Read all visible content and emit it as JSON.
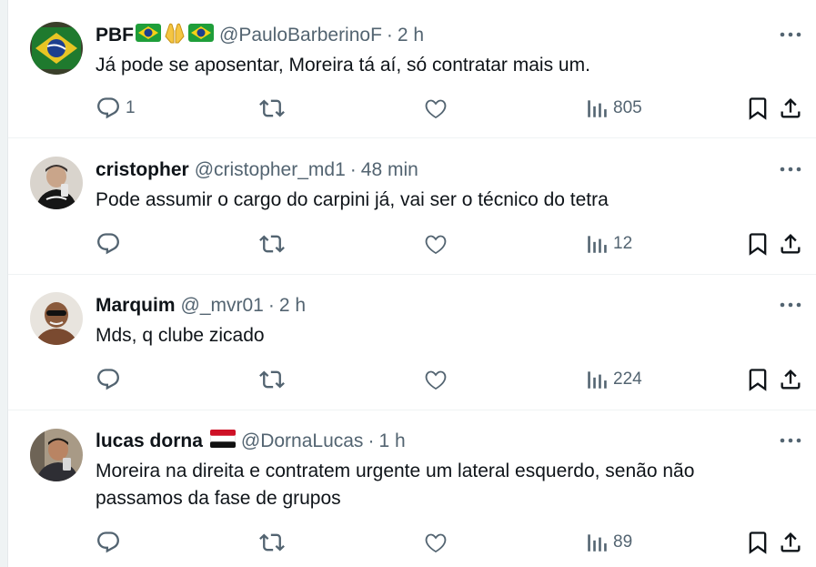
{
  "colors": {
    "text": "#0f1419",
    "secondary": "#536471",
    "divider": "#eff3f4",
    "background": "#ffffff"
  },
  "icons": {
    "reply": "reply-icon",
    "retweet": "retweet-icon",
    "like": "heart-icon",
    "views": "views-icon",
    "bookmark": "bookmark-icon",
    "share": "share-icon",
    "more": "more-icon"
  },
  "tweets": [
    {
      "name": "PBF",
      "flags": [
        "brazil-flag",
        "praying-hands-emoji",
        "brazil-flag"
      ],
      "handle": "@PauloBarberinoF",
      "separator": "·",
      "time": "2 h",
      "text": "Já pode se aposentar, Moreira tá aí, só contratar mais um.",
      "reply_count": "1",
      "retweet_count": "",
      "like_count": "",
      "views": "805"
    },
    {
      "name": "cristopher",
      "handle": "@cristopher_md1",
      "separator": "·",
      "time": "48 min",
      "text": "Pode assumir o cargo do carpini já, vai ser o técnico do tetra",
      "reply_count": "",
      "retweet_count": "",
      "like_count": "",
      "views": "12"
    },
    {
      "name": "Marquim",
      "handle": "@_mvr01",
      "separator": "·",
      "time": "2 h",
      "text": "Mds, q clube zicado",
      "reply_count": "",
      "retweet_count": "",
      "like_count": "",
      "views": "224"
    },
    {
      "name": "lucas dorna",
      "flags": [
        "flag-red-white-black"
      ],
      "handle": "@DornaLucas",
      "separator": "·",
      "time": "1 h",
      "text": "Moreira na direita e contratem urgente um lateral esquerdo, senão não passamos da fase de grupos",
      "reply_count": "",
      "retweet_count": "",
      "like_count": "",
      "views": "89"
    }
  ]
}
